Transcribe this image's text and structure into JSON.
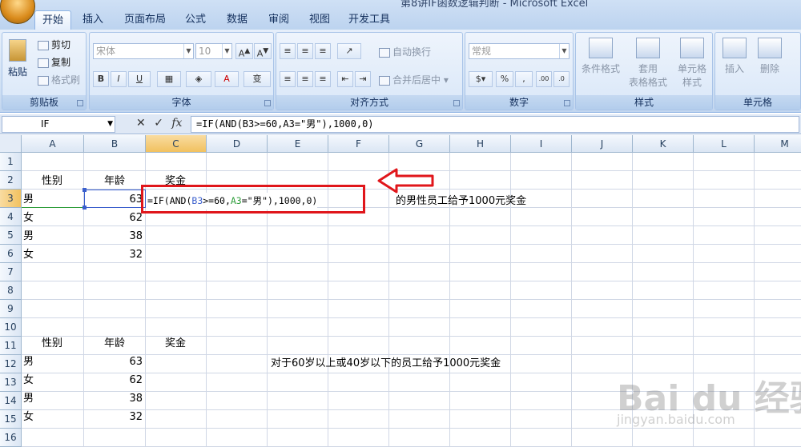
{
  "window": {
    "title": "第8讲IF函数逻辑判断 - Microsoft Excel"
  },
  "tabs": [
    "开始",
    "插入",
    "页面布局",
    "公式",
    "数据",
    "审阅",
    "视图",
    "开发工具"
  ],
  "ribbon": {
    "clipboard": {
      "label": "剪贴板",
      "paste": "粘贴",
      "cut": "剪切",
      "copy": "复制",
      "format_painter": "格式刷"
    },
    "font": {
      "label": "字体",
      "font_name": "宋体",
      "font_size": "10",
      "bold": "B",
      "italic": "I",
      "underline": "U"
    },
    "alignment": {
      "label": "对齐方式",
      "wrap_text": "自动换行",
      "merge_center": "合并后居中"
    },
    "number": {
      "label": "数字",
      "format": "常规",
      "percent": "%",
      "comma": ","
    },
    "styles": {
      "label": "样式",
      "conditional": "条件格式",
      "table_format_1": "套用",
      "table_format_2": "表格格式",
      "cell_style_1": "单元格",
      "cell_style_2": "样式"
    },
    "cells": {
      "label": "单元格",
      "insert": "插入",
      "delete": "删除"
    }
  },
  "formula_bar": {
    "name_box": "IF",
    "fx": "fx",
    "formula": "=IF(AND(B3>=60,A3=\"男\"),1000,0)"
  },
  "columns": [
    "A",
    "B",
    "C",
    "D",
    "E",
    "F",
    "G",
    "H",
    "I",
    "J",
    "K",
    "L",
    "M"
  ],
  "rows": [
    "1",
    "2",
    "3",
    "4",
    "5",
    "6",
    "7",
    "8",
    "9",
    "10",
    "11",
    "12",
    "13",
    "14",
    "15",
    "16"
  ],
  "table1": {
    "headers": [
      "性别",
      "年龄",
      "奖金"
    ],
    "rows": [
      [
        "男",
        "63"
      ],
      [
        "女",
        "62"
      ],
      [
        "男",
        "38"
      ],
      [
        "女",
        "32"
      ]
    ]
  },
  "table2": {
    "headers": [
      "性别",
      "年龄",
      "奖金"
    ],
    "rows": [
      [
        "男",
        "63"
      ],
      [
        "女",
        "62"
      ],
      [
        "男",
        "38"
      ],
      [
        "女",
        "32"
      ]
    ]
  },
  "editing_cell": {
    "prefix": "=IF(AND(",
    "ref1": "B3",
    "mid": ">=60,",
    "ref2": "A3",
    "suffix": "=\"男\"),1000,0)"
  },
  "notes": {
    "note1": "的男性员工给予1000元奖金",
    "note2": "对于60岁以上或40岁以下的员工给予1000元奖金"
  },
  "watermark": {
    "main": "Bai du 经验",
    "sub": "jingyan.baidu.com"
  },
  "colors": {
    "red_box": "#e0161b",
    "ref_blue": "#3a5fcd",
    "ref_green": "#2e9d3a"
  }
}
